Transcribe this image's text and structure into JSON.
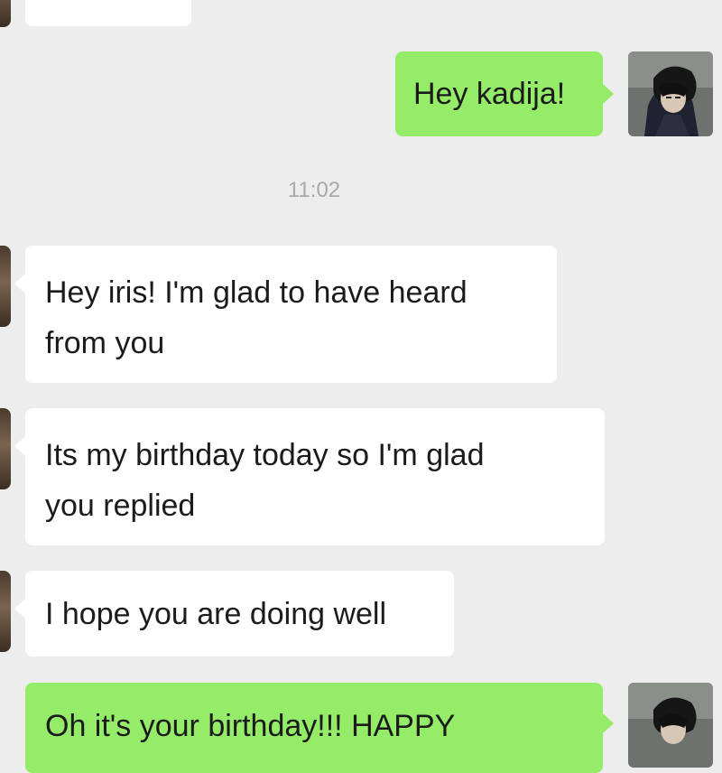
{
  "chat": {
    "timestamp": "11:02",
    "messages": [
      {
        "side": "in",
        "text": ""
      },
      {
        "side": "out",
        "text": "Hey kadija!"
      },
      {
        "side": "in",
        "text": "Hey iris! I'm glad to have heard\nfrom you"
      },
      {
        "side": "in",
        "text": "Its my birthday today so I'm glad\nyou replied"
      },
      {
        "side": "in",
        "text": "I hope you are doing well"
      },
      {
        "side": "out",
        "text": "Oh it's your birthday!!! HAPPY"
      }
    ]
  },
  "avatars": {
    "me": "anime-character-avatar",
    "other": "contact-avatar"
  },
  "colors": {
    "background": "#ededed",
    "outgoing_bubble": "#95ec69",
    "incoming_bubble": "#ffffff",
    "timestamp_text": "#a9a9a9"
  }
}
